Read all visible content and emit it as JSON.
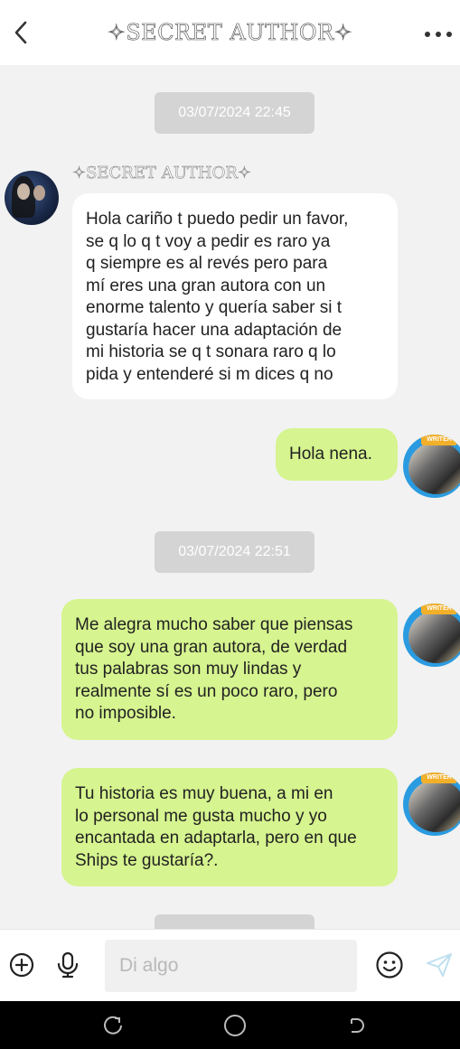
{
  "header": {
    "title": "✧SECRET AUTHOR✧"
  },
  "chat": {
    "timestamps": [
      "03/07/2024 22:45",
      "03/07/2024 22:51"
    ],
    "sender_name": "✧SECRET AUTHOR✧",
    "messages": [
      {
        "direction": "in",
        "text": "Hola cariño t puedo pedir un favor,\nse q lo q t voy a pedir es raro ya\nq siempre es al revés pero para\nmí eres una gran autora con un\nenorme talento y quería saber si t\ngustaría hacer una adaptación de\nmi historia se q t sonara raro q lo\npida y entenderé si m dices q no"
      },
      {
        "direction": "out",
        "text": "Hola nena."
      },
      {
        "direction": "out",
        "text": "Me alegra mucho saber que piensas\nque soy una gran autora, de verdad\ntus palabras son muy lindas y\nrealmente sí es un poco raro, pero\nno imposible."
      },
      {
        "direction": "out",
        "text": "Tu historia es muy buena, a mi en\nlo personal me gusta mucho y yo\nencantada en adaptarla, pero en que\nShips te gustaría?."
      }
    ],
    "avatar_badge": "WRITER"
  },
  "inputbar": {
    "placeholder": "Di algo",
    "icons": [
      "add-icon",
      "microphone-icon",
      "emoji-icon",
      "send-icon"
    ]
  },
  "colors": {
    "outgoing_bubble": "#d6f48f",
    "incoming_bubble": "#ffffff",
    "background": "#f2f2f2",
    "timestamp_bg": "#d4d4d4"
  }
}
